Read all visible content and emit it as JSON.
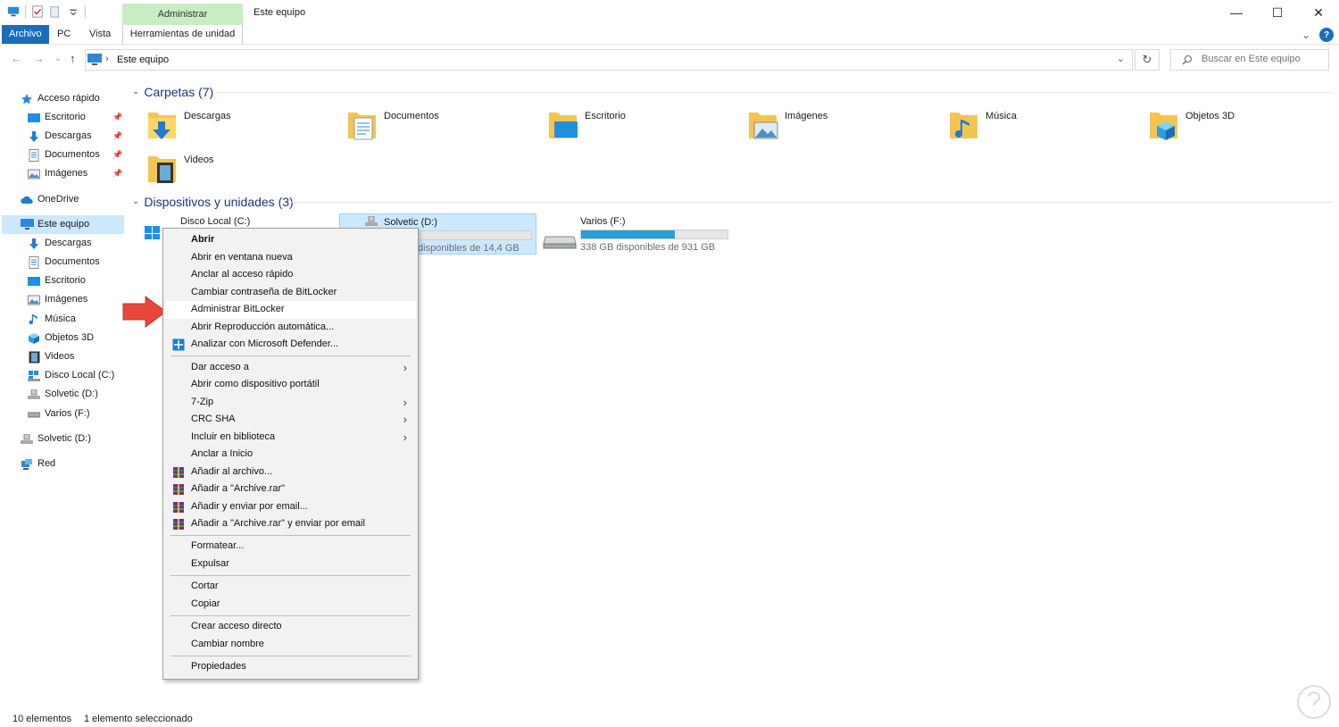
{
  "window": {
    "title": "Este equipo",
    "context_group": "Administrar",
    "controls": {
      "minimize": "—",
      "maximize": "☐",
      "close": "✕"
    }
  },
  "ribbon": {
    "tabs": [
      {
        "label": "Archivo"
      },
      {
        "label": "PC"
      },
      {
        "label": "Vista"
      },
      {
        "label": "Herramientas de unidad"
      }
    ],
    "expand": "⌄",
    "help": "?"
  },
  "address": {
    "back": "←",
    "forward": "→",
    "recent": "⌄",
    "up": "↑",
    "sep": "›",
    "path": "Este equipo",
    "dropdown": "⌄",
    "refresh": "↻",
    "search_placeholder": "Buscar en Este equipo"
  },
  "sidebar": {
    "items": [
      {
        "label": "Acceso rápido"
      },
      {
        "label": "Escritorio",
        "pin": "📌"
      },
      {
        "label": "Descargas",
        "pin": "📌"
      },
      {
        "label": "Documentos",
        "pin": "📌"
      },
      {
        "label": "Imágenes",
        "pin": "📌"
      },
      {
        "label": "OneDrive"
      },
      {
        "label": "Este equipo"
      },
      {
        "label": "Descargas"
      },
      {
        "label": "Documentos"
      },
      {
        "label": "Escritorio"
      },
      {
        "label": "Imágenes"
      },
      {
        "label": "Música"
      },
      {
        "label": "Objetos 3D"
      },
      {
        "label": "Videos"
      },
      {
        "label": "Disco Local (C:)"
      },
      {
        "label": "Solvetic (D:)"
      },
      {
        "label": "Varios (F:)"
      },
      {
        "label": "Solvetic (D:)"
      },
      {
        "label": "Red"
      }
    ]
  },
  "content": {
    "folders_header": "Carpetas (7)",
    "devices_header": "Dispositivos y unidades (3)",
    "chevron": "⌄",
    "folders": [
      {
        "name": "Descargas"
      },
      {
        "name": "Documentos"
      },
      {
        "name": "Escritorio"
      },
      {
        "name": "Imágenes"
      },
      {
        "name": "Música"
      },
      {
        "name": "Objetos 3D"
      },
      {
        "name": "Videos"
      }
    ],
    "drives": [
      {
        "name": "Disco Local (C:)"
      },
      {
        "name": "Solvetic (D:)",
        "free": "disponibles de 14,4 GB"
      },
      {
        "name": "Varios (F:)",
        "free": "338 GB disponibles de 931 GB",
        "used_fraction": 0.64
      }
    ]
  },
  "context_menu": {
    "items": [
      {
        "label": "Abrir"
      },
      {
        "label": "Abrir en ventana nueva"
      },
      {
        "label": "Anclar al acceso rápido"
      },
      {
        "label": "Cambiar contraseña de BitLocker"
      },
      {
        "label": "Administrar BitLocker"
      },
      {
        "label": "Abrir Reproducción automática..."
      },
      {
        "label": "Analizar con Microsoft Defender..."
      },
      {
        "label": "Dar acceso a"
      },
      {
        "label": "Abrir como dispositivo portátil"
      },
      {
        "label": "7-Zip"
      },
      {
        "label": "CRC SHA"
      },
      {
        "label": "Incluir en biblioteca"
      },
      {
        "label": "Anclar a Inicio"
      },
      {
        "label": "Añadir al archivo..."
      },
      {
        "label": "Añadir a \"Archive.rar\""
      },
      {
        "label": "Añadir y enviar por email..."
      },
      {
        "label": "Añadir a \"Archive.rar\" y enviar por email"
      },
      {
        "label": "Formatear..."
      },
      {
        "label": "Expulsar"
      },
      {
        "label": "Cortar"
      },
      {
        "label": "Copiar"
      },
      {
        "label": "Crear acceso directo"
      },
      {
        "label": "Cambiar nombre"
      },
      {
        "label": "Propiedades"
      }
    ],
    "submenu_glyph": "›"
  },
  "status": {
    "count": "10 elementos",
    "selection": "1 elemento seleccionado"
  },
  "colors": {
    "accent": "#1a6dbb",
    "selection": "#cce8ff",
    "drive_bar": "#26a0da",
    "context_tab": "#c7eec3",
    "arrow": "#e8473c"
  }
}
